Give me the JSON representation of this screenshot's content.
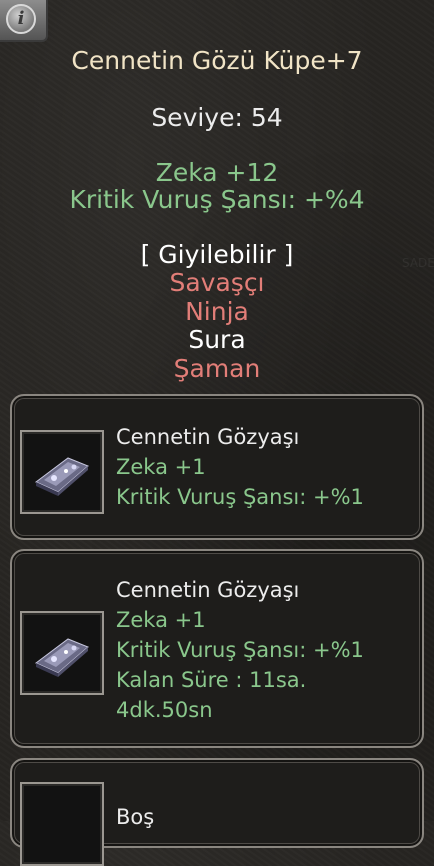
{
  "item": {
    "name": "Cennetin Gözü Küpe+7",
    "level": "Seviye: 54",
    "bonuses": [
      "Zeka +12",
      "Kritik Vuruş Şansı: +%4"
    ],
    "wearable_label": "[ Giyilebilir ]",
    "classes": [
      {
        "label": "Savaşçı",
        "color": "#e27e78"
      },
      {
        "label": "Ninja",
        "color": "#e27e78"
      },
      {
        "label": "Sura",
        "color": "#ffffff"
      },
      {
        "label": "Şaman",
        "color": "#e27e78"
      }
    ]
  },
  "background_text": [
    "SADE"
  ],
  "slots": [
    {
      "icon": "heaven-tear-stone-icon",
      "name": "Cennetin Gözyaşı",
      "stats": [
        "Zeka +1",
        "Kritik Vuruş Şansı: +%1"
      ]
    },
    {
      "icon": "heaven-tear-stone-icon",
      "name": "Cennetin Gözyaşı",
      "stats": [
        "Zeka +1",
        "Kritik Vuruş Şansı: +%1"
      ],
      "time_remaining": [
        "Kalan Süre : 11sa.",
        "4dk.50sn"
      ]
    },
    {
      "icon": "empty-socket-icon",
      "name": "Boş"
    }
  ],
  "colors": {
    "title": "#f1e4c6",
    "bonus": "#8ac78c",
    "restricted_class": "#e27e78",
    "allowed_class": "#ffffff"
  },
  "info_button_icon": "info-icon"
}
